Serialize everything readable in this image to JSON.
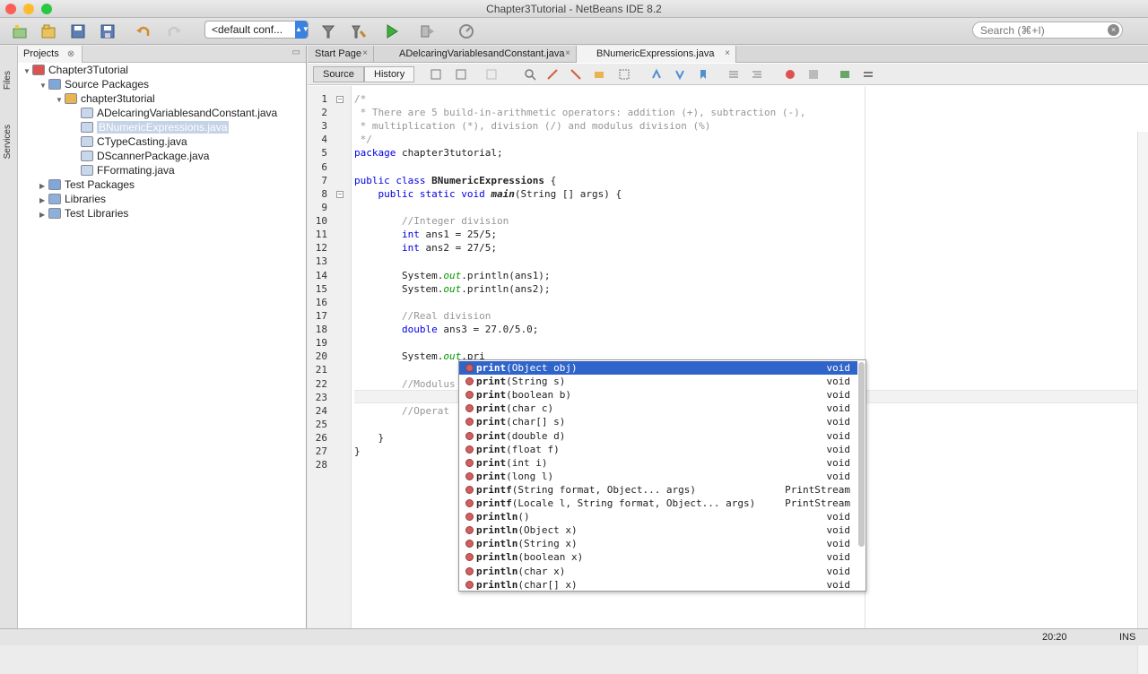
{
  "window": {
    "title": "Chapter3Tutorial - NetBeans IDE 8.2",
    "colors": {
      "close": "#fc5f57",
      "minimize": "#fdbc2e",
      "zoom": "#28c940"
    }
  },
  "toolbar": {
    "icons": [
      "new-project-icon",
      "open-project-icon",
      "save-all-icon",
      "save-icon",
      "undo-icon",
      "redo-icon",
      "clean-build-icon",
      "build-icon",
      "run-icon",
      "debug-icon",
      "profile-icon"
    ],
    "config": "<default conf...",
    "search_placeholder": "Search (⌘+I)"
  },
  "side_tabs": [
    "Files",
    "Services"
  ],
  "projects": {
    "tab_label": "Projects",
    "tree": [
      {
        "label": "Chapter3Tutorial",
        "level": 0,
        "expanded": true,
        "icon": "project-icon"
      },
      {
        "label": "Source Packages",
        "level": 1,
        "expanded": true,
        "icon": "package-folder-icon"
      },
      {
        "label": "chapter3tutorial",
        "level": 2,
        "expanded": true,
        "icon": "package-icon"
      },
      {
        "label": "ADelcaringVariablesandConstant.java",
        "level": 3,
        "icon": "java-file-icon"
      },
      {
        "label": "BNumericExpressions.java",
        "level": 3,
        "icon": "java-file-icon",
        "selected": true
      },
      {
        "label": "CTypeCasting.java",
        "level": 3,
        "icon": "java-file-icon"
      },
      {
        "label": "DScannerPackage.java",
        "level": 3,
        "icon": "java-file-icon"
      },
      {
        "label": "FFormating.java",
        "level": 3,
        "icon": "java-file-icon"
      },
      {
        "label": "Test Packages",
        "level": 1,
        "expanded": false,
        "icon": "package-folder-icon"
      },
      {
        "label": "Libraries",
        "level": 1,
        "expanded": false,
        "icon": "library-icon"
      },
      {
        "label": "Test Libraries",
        "level": 1,
        "expanded": false,
        "icon": "library-icon"
      }
    ]
  },
  "editor": {
    "tabs": [
      {
        "label": "Start Page",
        "active": false
      },
      {
        "label": "ADelcaringVariablesandConstant.java",
        "active": false
      },
      {
        "label": "BNumericExpressions.java",
        "active": true
      }
    ],
    "source_label": "Source",
    "history_label": "History",
    "code_lines": [
      "/*",
      " * There are 5 build-in-arithmetic operators: addition (+), subtraction (-),",
      " * multiplication (*), division (/) and modulus division (%)",
      " */",
      "package chapter3tutorial;",
      "",
      "public class BNumericExpressions {",
      "    public static void main(String [] args) {",
      "",
      "        //Integer division",
      "        int ans1 = 25/5;",
      "        int ans2 = 27/5;",
      "",
      "        System.out.println(ans1);",
      "        System.out.println(ans2);",
      "",
      "        //Real division",
      "        double ans3 = 27.0/5.0;",
      "",
      "        System.out.pri",
      "",
      "        //Modulus",
      "",
      "        //Operat",
      "",
      "    }",
      "}",
      ""
    ]
  },
  "completion": {
    "items": [
      {
        "name": "print",
        "params": "(Object obj)",
        "ret": "void",
        "selected": true
      },
      {
        "name": "print",
        "params": "(String s)",
        "ret": "void"
      },
      {
        "name": "print",
        "params": "(boolean b)",
        "ret": "void"
      },
      {
        "name": "print",
        "params": "(char c)",
        "ret": "void"
      },
      {
        "name": "print",
        "params": "(char[] s)",
        "ret": "void"
      },
      {
        "name": "print",
        "params": "(double d)",
        "ret": "void"
      },
      {
        "name": "print",
        "params": "(float f)",
        "ret": "void"
      },
      {
        "name": "print",
        "params": "(int i)",
        "ret": "void"
      },
      {
        "name": "print",
        "params": "(long l)",
        "ret": "void"
      },
      {
        "name": "printf",
        "params": "(String format, Object... args)",
        "ret": "PrintStream"
      },
      {
        "name": "printf",
        "params": "(Locale l, String format, Object... args)",
        "ret": "PrintStream"
      },
      {
        "name": "println",
        "params": "()",
        "ret": "void"
      },
      {
        "name": "println",
        "params": "(Object x)",
        "ret": "void"
      },
      {
        "name": "println",
        "params": "(String x)",
        "ret": "void"
      },
      {
        "name": "println",
        "params": "(boolean x)",
        "ret": "void"
      },
      {
        "name": "println",
        "params": "(char x)",
        "ret": "void"
      },
      {
        "name": "println",
        "params": "(char[] x)",
        "ret": "void"
      }
    ]
  },
  "status": {
    "position": "20:20",
    "mode": "INS"
  }
}
